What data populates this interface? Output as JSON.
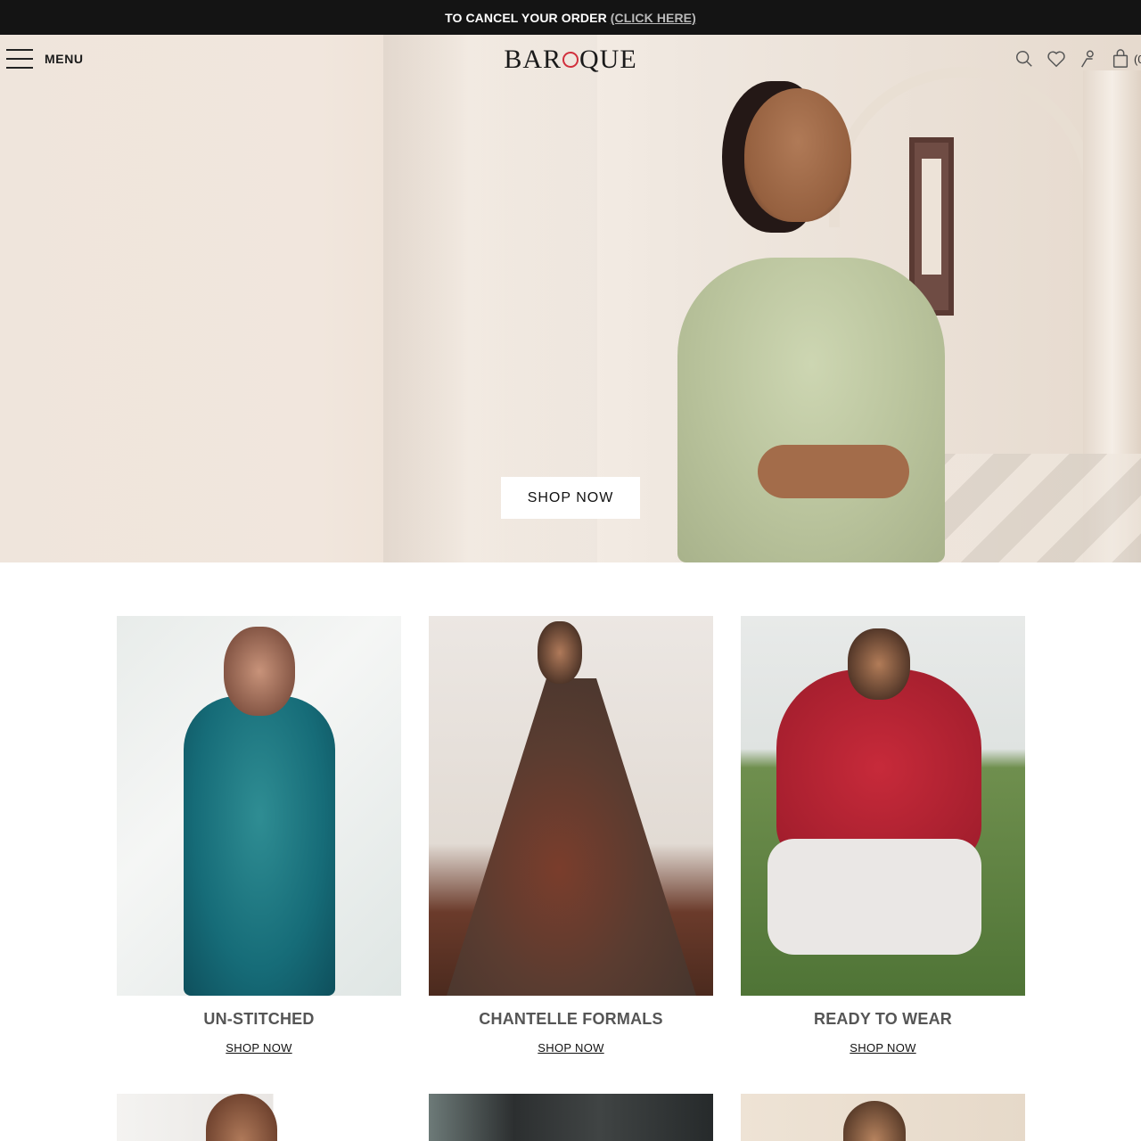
{
  "announcement": {
    "text": "TO CANCEL YOUR ORDER",
    "link": "(CLICK HERE)"
  },
  "header": {
    "menu_label": "MENU",
    "logo_left": "BAR",
    "logo_right": "QUE",
    "cart_count": "(0",
    "icons": [
      "search-icon",
      "heart-icon",
      "user-icon",
      "bag-icon"
    ]
  },
  "hero": {
    "cta": "SHOP NOW"
  },
  "categories": [
    {
      "title": "UN-STITCHED",
      "link": "SHOP NOW"
    },
    {
      "title": "CHANTELLE FORMALS",
      "link": "SHOP NOW"
    },
    {
      "title": "READY TO WEAR",
      "link": "SHOP NOW"
    }
  ],
  "colors": {
    "announcement_bg": "#141414",
    "logo_accent": "#d12f3c",
    "category_title": "#555555"
  }
}
